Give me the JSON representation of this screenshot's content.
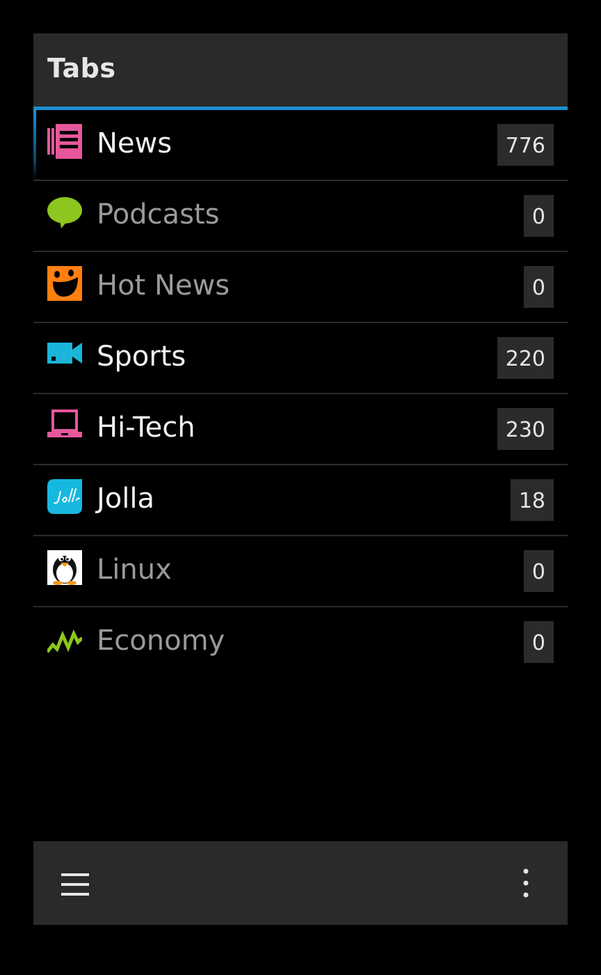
{
  "header": {
    "title": "Tabs"
  },
  "colors": {
    "accent": "#1a8fd0",
    "background": "#000000",
    "panel": "#2a2a2a"
  },
  "tabs": [
    {
      "label": "News",
      "count": "776",
      "icon": "newspaper-icon",
      "active": true
    },
    {
      "label": "Podcasts",
      "count": "0",
      "icon": "speech-bubble-icon",
      "active": false
    },
    {
      "label": "Hot News",
      "count": "0",
      "icon": "smiley-icon",
      "active": false
    },
    {
      "label": "Sports",
      "count": "220",
      "icon": "video-camera-icon",
      "active": true
    },
    {
      "label": "Hi-Tech",
      "count": "230",
      "icon": "laptop-icon",
      "active": true
    },
    {
      "label": "Jolla",
      "count": "18",
      "icon": "jolla-logo-icon",
      "active": true
    },
    {
      "label": "Linux",
      "count": "0",
      "icon": "penguin-icon",
      "active": false
    },
    {
      "label": "Economy",
      "count": "0",
      "icon": "activity-graph-icon",
      "active": false
    }
  ],
  "toolbar": {
    "menu_icon": "hamburger-menu-icon",
    "more_icon": "more-vertical-icon"
  }
}
